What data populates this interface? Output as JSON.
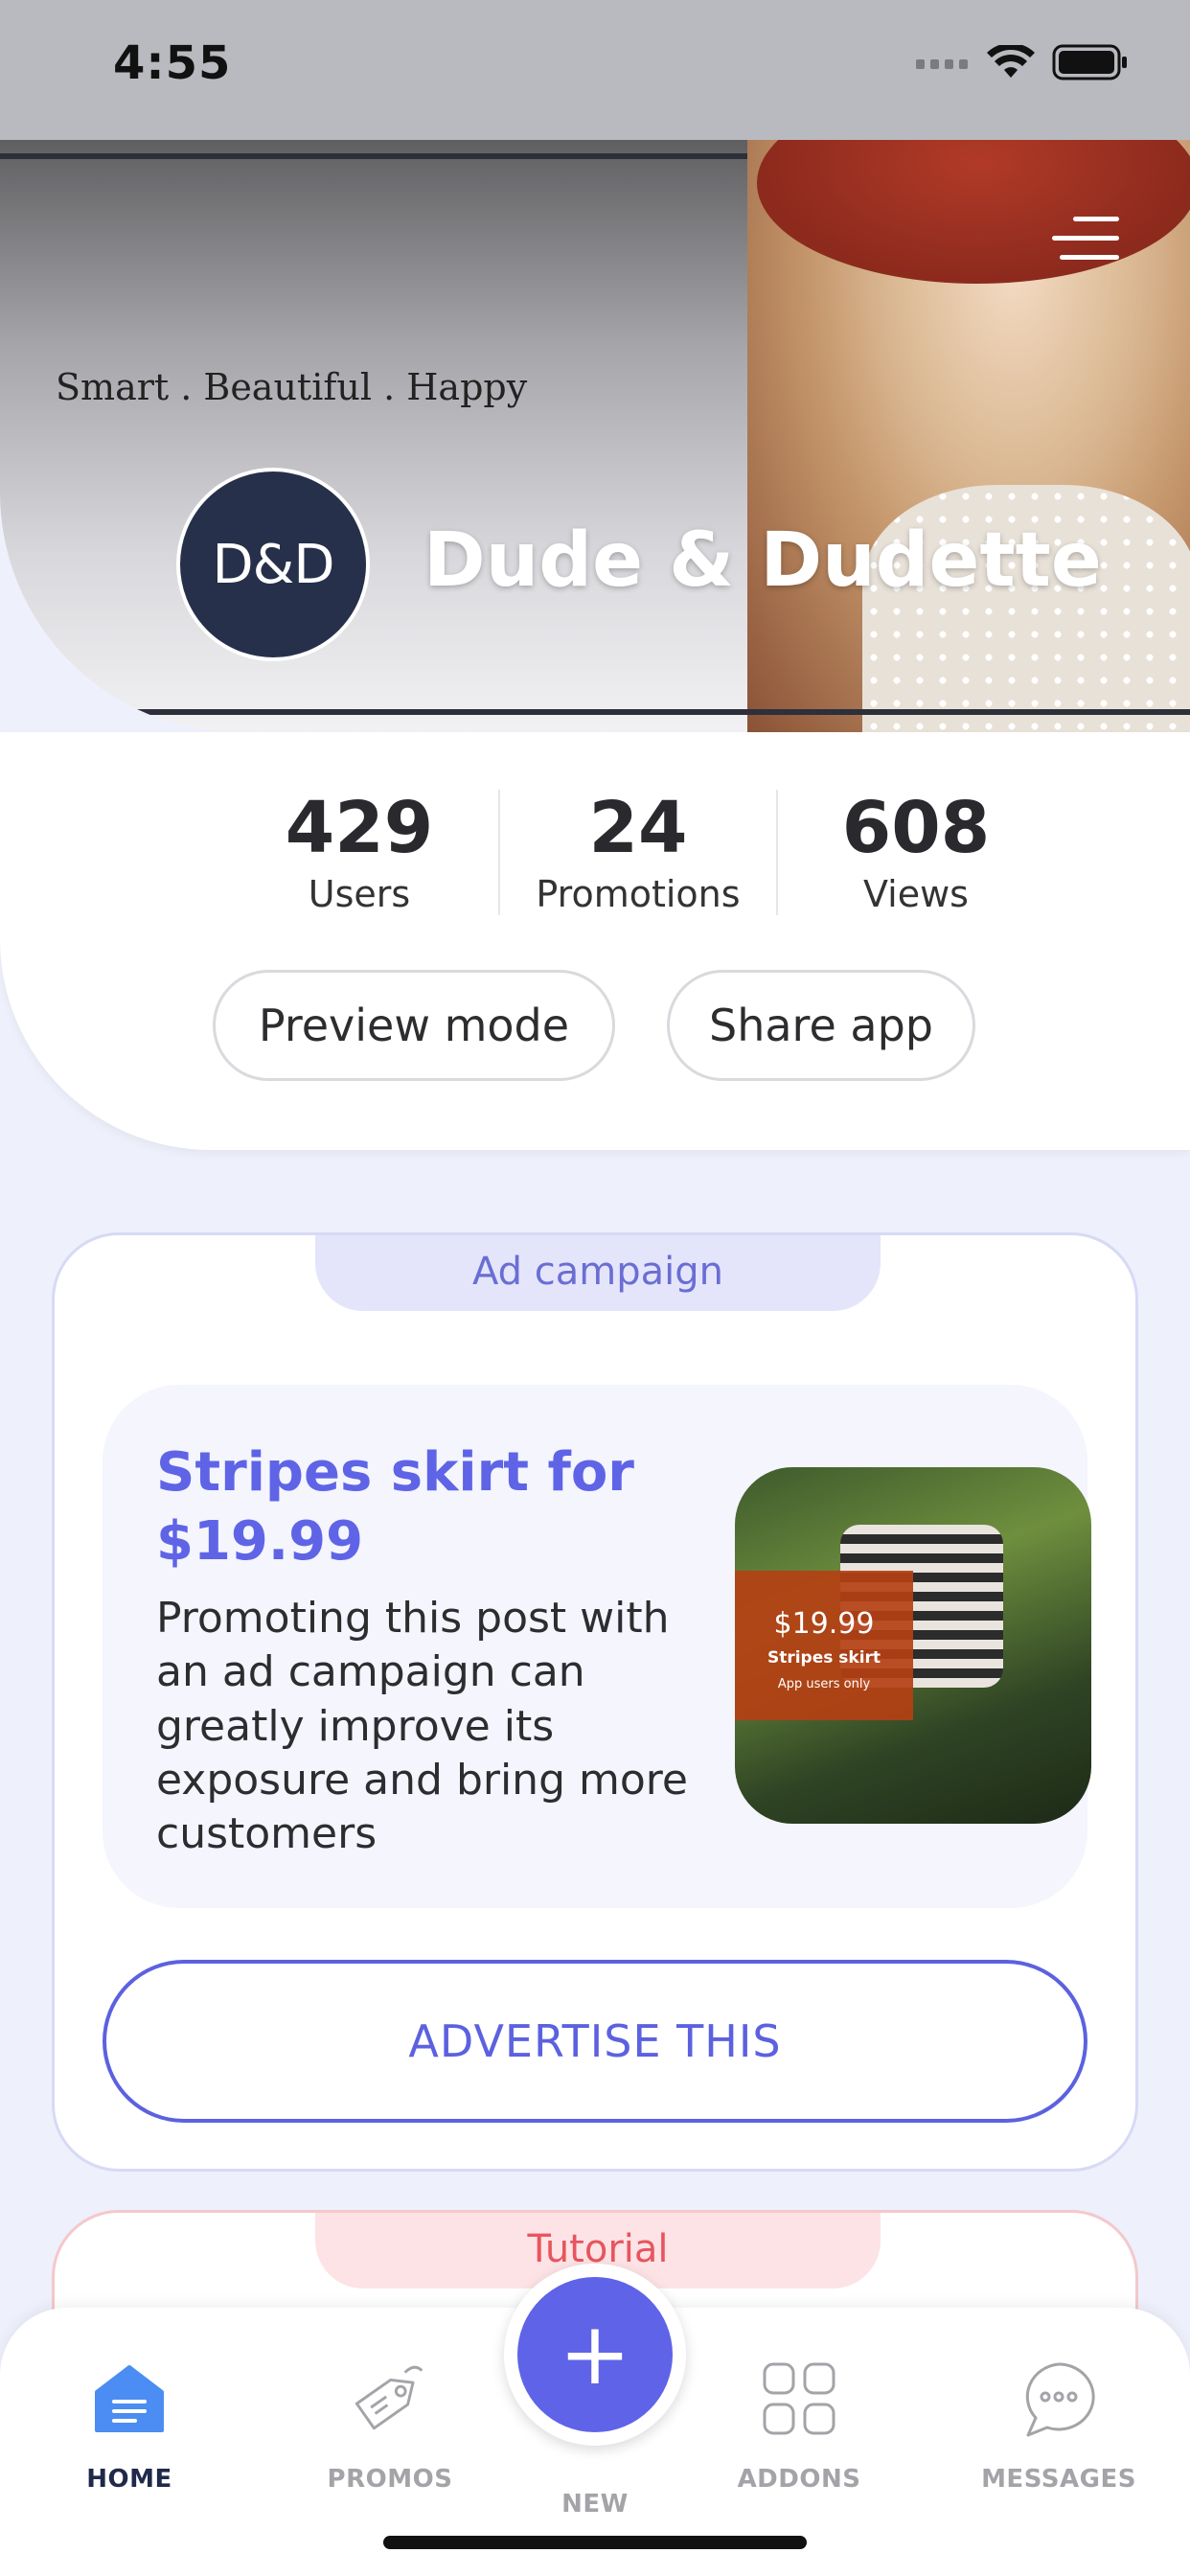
{
  "status_bar": {
    "time": "4:55",
    "icons": [
      "signal-icon",
      "wifi-icon",
      "battery-icon"
    ]
  },
  "header": {
    "tagline": "Smart . Beautiful . Happy",
    "logo_text": "D&D",
    "brand_name": "Dude & Dudette",
    "menu_icon": "hamburger-menu-icon"
  },
  "stats": [
    {
      "value": "429",
      "label": "Users"
    },
    {
      "value": "24",
      "label": "Promotions"
    },
    {
      "value": "608",
      "label": "Views"
    }
  ],
  "actions": {
    "preview_label": "Preview mode",
    "share_label": "Share app"
  },
  "ad_campaign": {
    "tab_label": "Ad campaign",
    "title": "Stripes skirt for $19.99",
    "description": "Promoting this post with an ad campaign can greatly improve its exposure and bring more customers",
    "image_price": "$19.99",
    "image_product": "Stripes skirt",
    "image_note": "App users only",
    "button_label": "ADVERTISE THIS"
  },
  "tutorial": {
    "tab_label": "Tutorial"
  },
  "tab_bar": {
    "items": [
      {
        "label": "HOME",
        "icon": "home-icon",
        "active": true
      },
      {
        "label": "PROMOS",
        "icon": "tag-icon",
        "active": false
      },
      {
        "label": "NEW",
        "icon": "plus-icon",
        "active": false
      },
      {
        "label": "ADDONS",
        "icon": "grid-icon",
        "active": false
      },
      {
        "label": "MESSAGES",
        "icon": "chat-icon",
        "active": false
      }
    ]
  },
  "colors": {
    "accent": "#5e63e8",
    "ad_tab_bg": "#e4e5fb",
    "tutorial_accent": "#e8555e",
    "logo_bg": "#26304a",
    "active_tab": "#1f2a4a",
    "inactive_tab": "#a3a3a8"
  }
}
